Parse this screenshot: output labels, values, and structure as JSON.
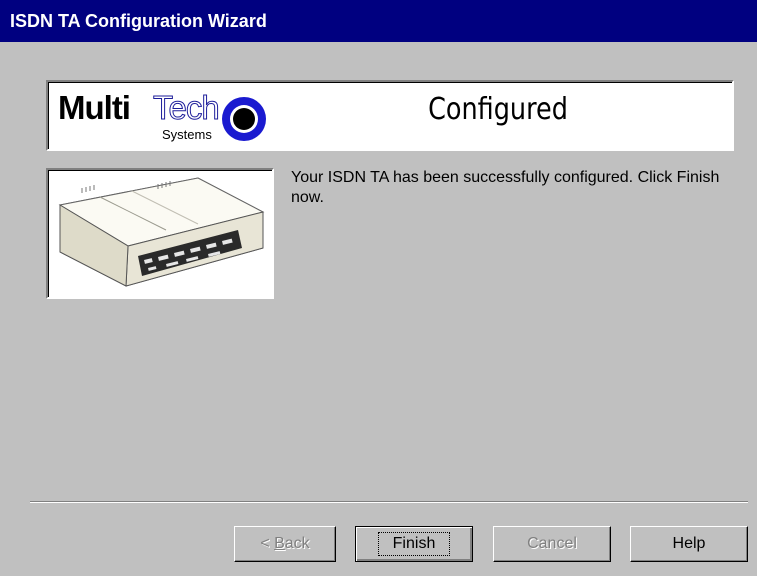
{
  "window": {
    "title": "ISDN TA Configuration Wizard"
  },
  "banner": {
    "logo_text": "Multi Tech Systems",
    "title": "Configured"
  },
  "image": {
    "alt": "ISDN TA device illustration"
  },
  "message": "Your ISDN TA has been successfully configured.  Click Finish now.",
  "buttons": {
    "back": {
      "prefix": "< ",
      "mnemonic": "B",
      "rest": "ack",
      "enabled": false
    },
    "finish": {
      "label": "Finish",
      "enabled": true,
      "default": true
    },
    "cancel": {
      "label": "Cancel",
      "enabled": false
    },
    "help": {
      "label": "Help",
      "enabled": true
    }
  },
  "colors": {
    "title_bar": "#000080",
    "dialog_face": "#c0c0c0",
    "logo_accent": "#1a1ad0"
  }
}
